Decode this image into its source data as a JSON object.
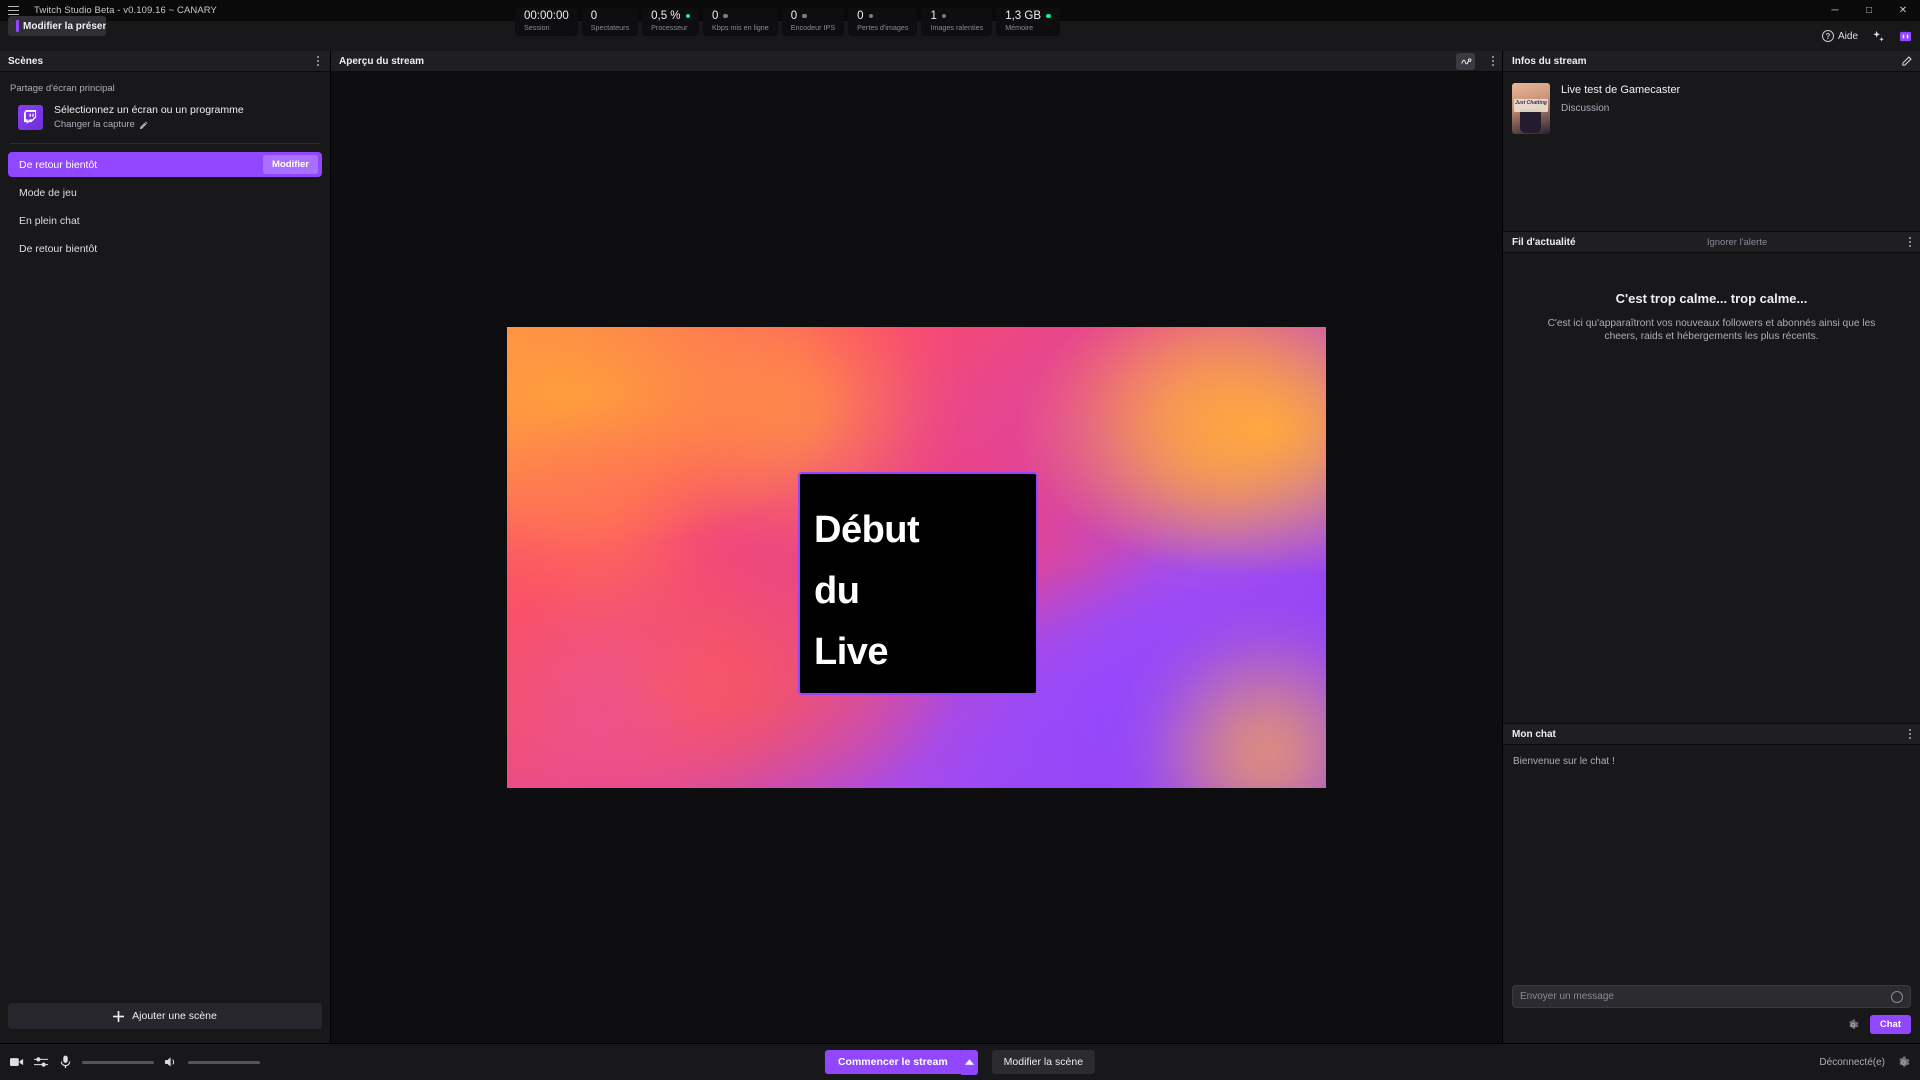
{
  "window": {
    "title": "Twitch Studio Beta - v0.109.16 ~ CANARY",
    "menu_icon": "hamburger-icon",
    "minimize": "─",
    "maximize": "□",
    "close": "✕"
  },
  "topbar": {
    "present_button": "Modifier la présentatio",
    "help_label": "Aide",
    "stats": [
      {
        "value": "00:00:00",
        "label": "Session",
        "dot": "none"
      },
      {
        "value": "0",
        "label": "Spectateurs",
        "dot": "none"
      },
      {
        "value": "0,5 %",
        "label": "Processeur",
        "dot": "green"
      },
      {
        "value": "0",
        "label": "Kbps mis en ligne",
        "dot": "grey"
      },
      {
        "value": "0",
        "label": "Encodeur IPS",
        "dot": "grey"
      },
      {
        "value": "0",
        "label": "Pertes d'images",
        "dot": "grey"
      },
      {
        "value": "1",
        "label": "Images ralenties",
        "dot": "grey"
      },
      {
        "value": "1,3 GB",
        "label": "Mémoire",
        "dot": "green"
      }
    ]
  },
  "scenes_panel": {
    "title": "Scènes",
    "screen_share_label": "Partage d'écran principal",
    "capture_title": "Sélectionnez un écran ou un programme",
    "capture_change": "Changer la capture",
    "items": [
      {
        "label": "De retour bientôt",
        "active": true,
        "action": "Modifier"
      },
      {
        "label": "Mode de jeu",
        "active": false,
        "action": ""
      },
      {
        "label": "En plein chat",
        "active": false,
        "action": ""
      },
      {
        "label": "De retour bientôt",
        "active": false,
        "action": ""
      }
    ],
    "add_scene": "Ajouter une scène"
  },
  "preview": {
    "title": "Aperçu du stream",
    "card_lines": [
      "Début",
      "du",
      "Live"
    ]
  },
  "stream_info": {
    "title": "Infos du stream",
    "stream_title": "Live test de Gamecaster",
    "category": "Discussion",
    "thumb_text": "Just Chatting"
  },
  "feed": {
    "title": "Fil d'actualité",
    "ignore_link": "Ignorer l'alerte",
    "empty_heading": "C'est trop calme... trop calme...",
    "empty_body": "C'est ici qu'apparaîtront vos nouveaux followers et abonnés ainsi que les cheers, raids et hébergements les plus récents."
  },
  "chat": {
    "title": "Mon chat",
    "welcome": "Bienvenue sur le chat !",
    "placeholder": "Envoyer un message",
    "send_button": "Chat"
  },
  "bottombar": {
    "go_live": "Commencer le stream",
    "modify_scene": "Modifier la scène",
    "status": "Déconnecté(e)"
  },
  "colors": {
    "accent": "#9147ff",
    "accent_light": "#a970ff",
    "online": "#00f593",
    "panel": "#18181b",
    "header": "#1f1f23",
    "bg": "#0e0e10"
  }
}
